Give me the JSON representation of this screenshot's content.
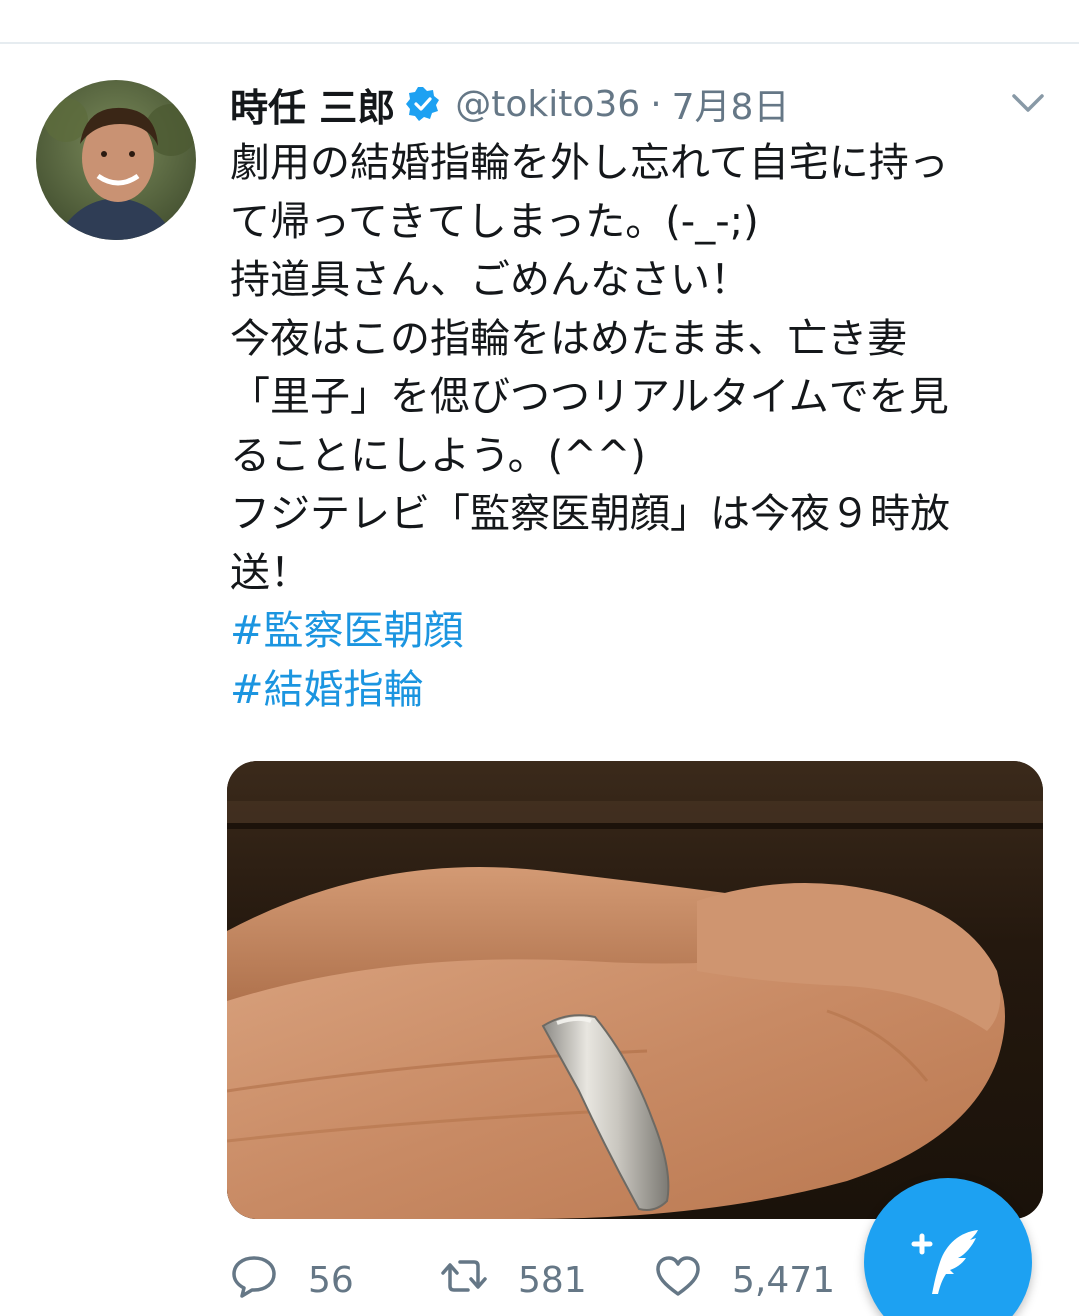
{
  "tweet": {
    "display_name": "時任 三郎",
    "handle": "@tokito36",
    "separator": "·",
    "date": "7月8日",
    "verified": true,
    "text_lines": [
      "劇用の結婚指輪を外し忘れて自宅に持っ",
      "て帰ってきてしまった。(-_-;)",
      "持道具さん、ごめんなさい！",
      "今夜はこの指輪をはめたまま、亡き妻",
      "「里子」を偲びつつリアルタイムでを見",
      "ることにしよう。(^^)",
      "フジテレビ「監察医朝顔」は今夜９時放",
      "送！"
    ],
    "hashtags": [
      "#監察医朝顔",
      "#結婚指輪"
    ]
  },
  "actions": {
    "reply_count": "56",
    "retweet_count": "581",
    "like_count": "5,471"
  },
  "icons": {
    "verified": "verified-badge-icon",
    "caret": "chevron-down-icon",
    "reply": "reply-icon",
    "retweet": "retweet-icon",
    "like": "heart-icon",
    "compose": "compose-tweet-icon"
  },
  "colors": {
    "accent": "#1da1f2",
    "hashtag": "#1b95e0",
    "secondary_text": "#657786"
  }
}
